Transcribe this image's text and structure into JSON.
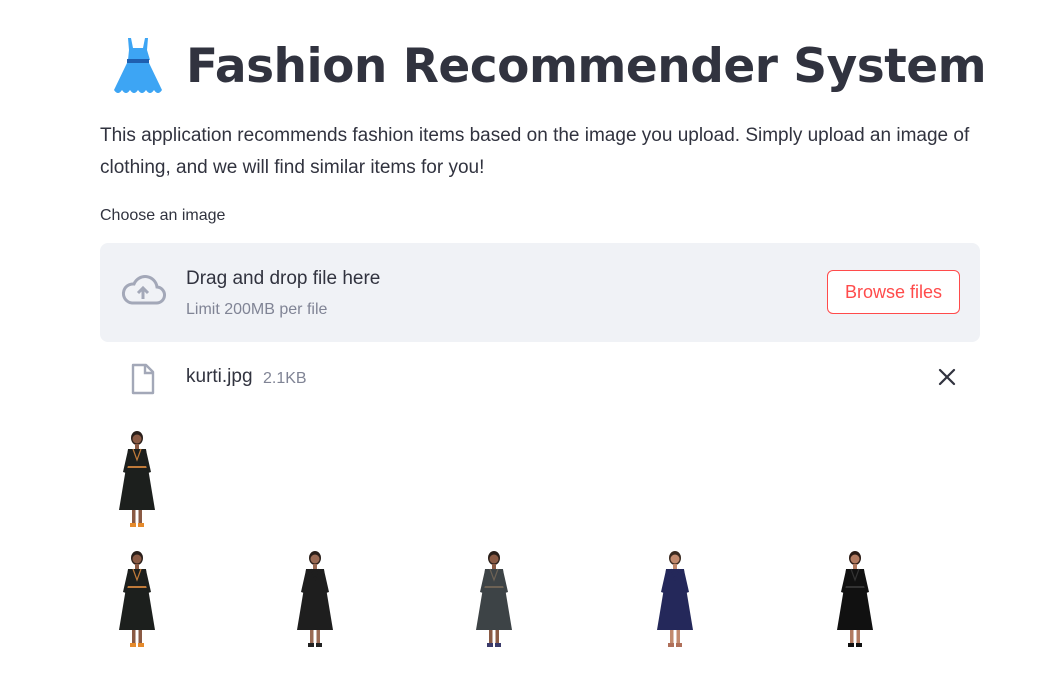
{
  "header": {
    "title": "Fashion Recommender System",
    "icon": "dress-icon"
  },
  "description": "This application recommends fashion items based on the image you upload. Simply upload an image of clothing, and we will find similar items for you!",
  "uploader": {
    "label": "Choose an image",
    "drop_text": "Drag and drop file here",
    "limit_text": "Limit 200MB per file",
    "browse_label": "Browse files"
  },
  "uploaded_file": {
    "name": "kurti.jpg",
    "size": "2.1KB"
  },
  "uploaded_preview": {
    "description": "uploaded image preview"
  },
  "recommendations": [
    {
      "variant": "black-embroidered"
    },
    {
      "variant": "black-vneck"
    },
    {
      "variant": "gray-kurti"
    },
    {
      "variant": "navy"
    },
    {
      "variant": "black-lace"
    }
  ],
  "colors": {
    "accent": "#ff4b4b",
    "text": "#31333f",
    "muted": "#808495",
    "dropzone_bg": "#f0f2f6",
    "dress_icon": "#3da5f4"
  }
}
